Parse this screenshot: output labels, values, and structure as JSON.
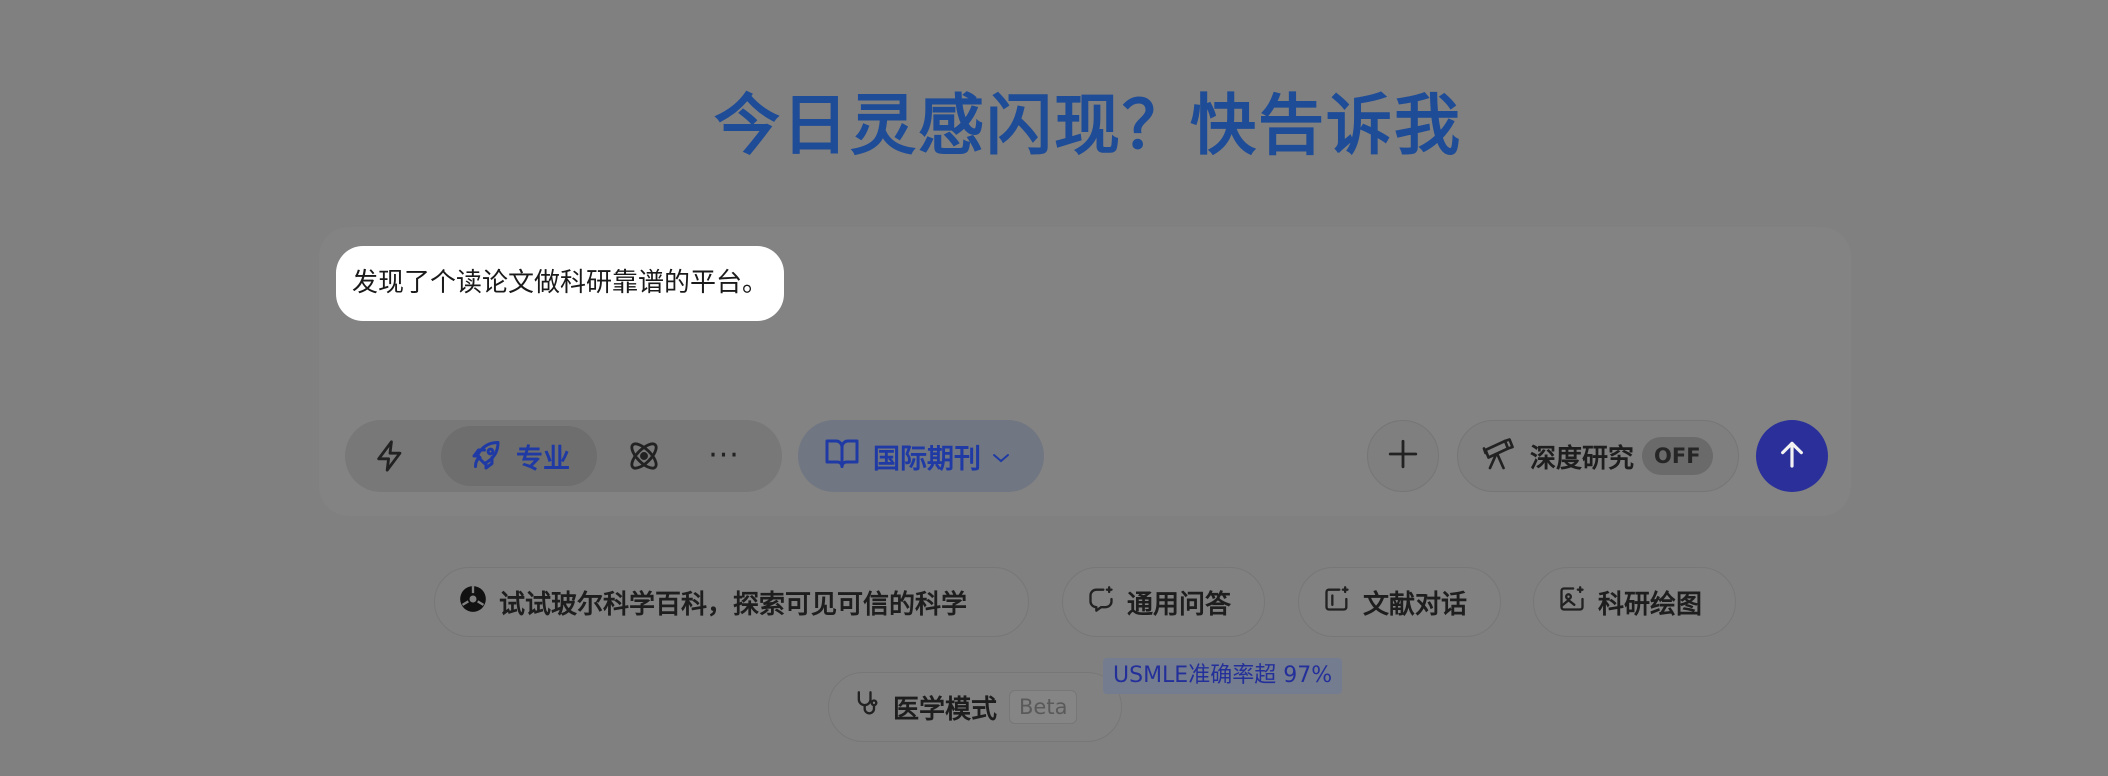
{
  "headline": "今日灵感闪现？快告诉我",
  "input": {
    "value": "发现了个读论文做科研靠谱的平台。"
  },
  "modes": {
    "fast_icon": "lightning-icon",
    "pro_icon": "rocket-icon",
    "pro_label": "专业",
    "atom_icon": "atom-icon",
    "more_label": "···"
  },
  "source": {
    "icon": "book-open-icon",
    "label": "国际期刊"
  },
  "research": {
    "icon": "telescope-icon",
    "label": "深度研究",
    "toggle": "OFF"
  },
  "suggestions": {
    "baike": "试试玻尔科学百科，探索可见可信的科学",
    "qa": "通用问答",
    "lit": "文献对话",
    "draw": "科研绘图",
    "medical": "医学模式",
    "medical_badge": "Beta",
    "medical_tip": "USMLE准确率超 97%"
  },
  "colors": {
    "overlay": "#808080",
    "headline": "#1f4c96",
    "accent": "#2a2f9a",
    "active_text": "#1f3aa5"
  }
}
